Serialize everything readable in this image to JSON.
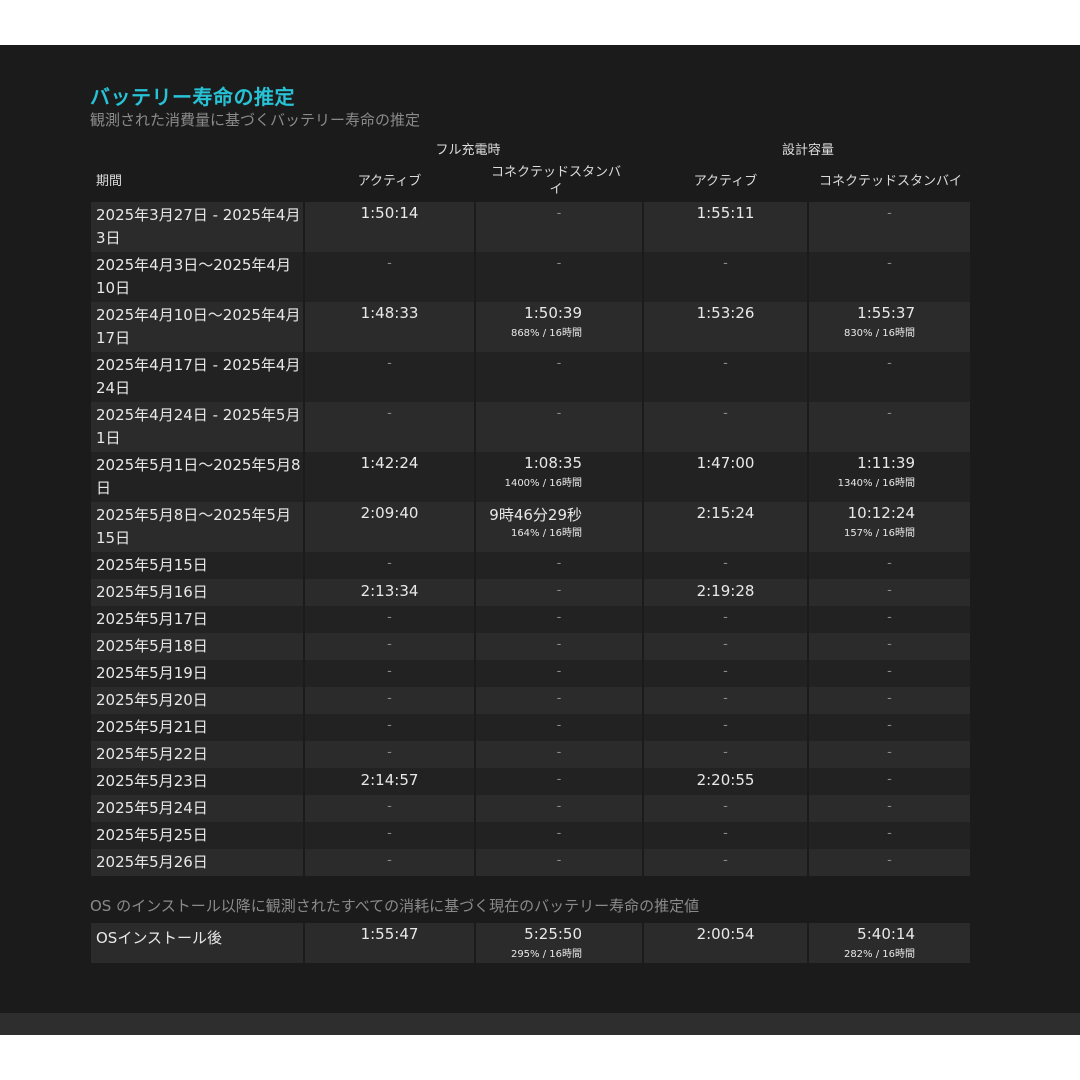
{
  "title": "バッテリー寿命の推定",
  "subtitle": "観測された消費量に基づくバッテリー寿命の推定",
  "groups": {
    "full_charge": "フル充電時",
    "design_capacity": "設計容量"
  },
  "columns": {
    "period": "期間",
    "active_full": "アクティブ",
    "standby_full": "コネクテッドスタンバイ",
    "active_design": "アクティブ",
    "standby_design": "コネクテッドスタンバイ"
  },
  "rows": [
    {
      "period": "2025年3月27日 - 2025年4月3日",
      "a1": "1:50:14",
      "s1": "-",
      "s1_sub": "",
      "a2": "1:55:11",
      "s2": "-",
      "s2_sub": ""
    },
    {
      "period": "2025年4月3日～2025年4月10日",
      "a1": "-",
      "s1": "-",
      "s1_sub": "",
      "a2": "-",
      "s2": "-",
      "s2_sub": ""
    },
    {
      "period": "2025年4月10日～2025年4月17日",
      "a1": "1:48:33",
      "s1": "1:50:39",
      "s1_sub": "868% / 16時間",
      "a2": "1:53:26",
      "s2": "1:55:37",
      "s2_sub": "830% / 16時間"
    },
    {
      "period": "2025年4月17日 - 2025年4月24日",
      "a1": "-",
      "s1": "-",
      "s1_sub": "",
      "a2": "-",
      "s2": "-",
      "s2_sub": ""
    },
    {
      "period": "2025年4月24日 - 2025年5月1日",
      "a1": "-",
      "s1": "-",
      "s1_sub": "",
      "a2": "-",
      "s2": "-",
      "s2_sub": ""
    },
    {
      "period": "2025年5月1日～2025年5月8日",
      "a1": "1:42:24",
      "s1": "1:08:35",
      "s1_sub": "1400% / 16時間",
      "a2": "1:47:00",
      "s2": "1:11:39",
      "s2_sub": "1340% / 16時間"
    },
    {
      "period": "2025年5月8日～2025年5月15日",
      "a1": "2:09:40",
      "s1": "9時46分29秒",
      "s1_sub": "164% / 16時間",
      "a2": "2:15:24",
      "s2": "10:12:24",
      "s2_sub": "157% / 16時間"
    },
    {
      "period": "2025年5月15日",
      "a1": "-",
      "s1": "-",
      "s1_sub": "",
      "a2": "-",
      "s2": "-",
      "s2_sub": ""
    },
    {
      "period": "2025年5月16日",
      "a1": "2:13:34",
      "s1": "-",
      "s1_sub": "",
      "a2": "2:19:28",
      "s2": "-",
      "s2_sub": ""
    },
    {
      "period": "2025年5月17日",
      "a1": "-",
      "s1": "-",
      "s1_sub": "",
      "a2": "-",
      "s2": "-",
      "s2_sub": ""
    },
    {
      "period": "2025年5月18日",
      "a1": "-",
      "s1": "-",
      "s1_sub": "",
      "a2": "-",
      "s2": "-",
      "s2_sub": ""
    },
    {
      "period": "2025年5月19日",
      "a1": "-",
      "s1": "-",
      "s1_sub": "",
      "a2": "-",
      "s2": "-",
      "s2_sub": ""
    },
    {
      "period": "2025年5月20日",
      "a1": "-",
      "s1": "-",
      "s1_sub": "",
      "a2": "-",
      "s2": "-",
      "s2_sub": ""
    },
    {
      "period": "2025年5月21日",
      "a1": "-",
      "s1": "-",
      "s1_sub": "",
      "a2": "-",
      "s2": "-",
      "s2_sub": ""
    },
    {
      "period": "2025年5月22日",
      "a1": "-",
      "s1": "-",
      "s1_sub": "",
      "a2": "-",
      "s2": "-",
      "s2_sub": ""
    },
    {
      "period": "2025年5月23日",
      "a1": "2:14:57",
      "s1": "-",
      "s1_sub": "",
      "a2": "2:20:55",
      "s2": "-",
      "s2_sub": ""
    },
    {
      "period": "2025年5月24日",
      "a1": "-",
      "s1": "-",
      "s1_sub": "",
      "a2": "-",
      "s2": "-",
      "s2_sub": ""
    },
    {
      "period": "2025年5月25日",
      "a1": "-",
      "s1": "-",
      "s1_sub": "",
      "a2": "-",
      "s2": "-",
      "s2_sub": ""
    },
    {
      "period": "2025年5月26日",
      "a1": "-",
      "s1": "-",
      "s1_sub": "",
      "a2": "-",
      "s2": "-",
      "s2_sub": ""
    }
  ],
  "os_note": "OS のインストール以降に観測されたすべての消耗に基づく現在のバッテリー寿命の推定値",
  "os_row": {
    "label": "OSインストール後",
    "a1": "1:55:47",
    "s1": "5:25:50",
    "s1_sub": "295% / 16時間",
    "a2": "2:00:54",
    "s2": "5:40:14",
    "s2_sub": "282% / 16時間"
  },
  "colors": {
    "accent": "#27c2d6",
    "background": "#1b1b1b"
  }
}
